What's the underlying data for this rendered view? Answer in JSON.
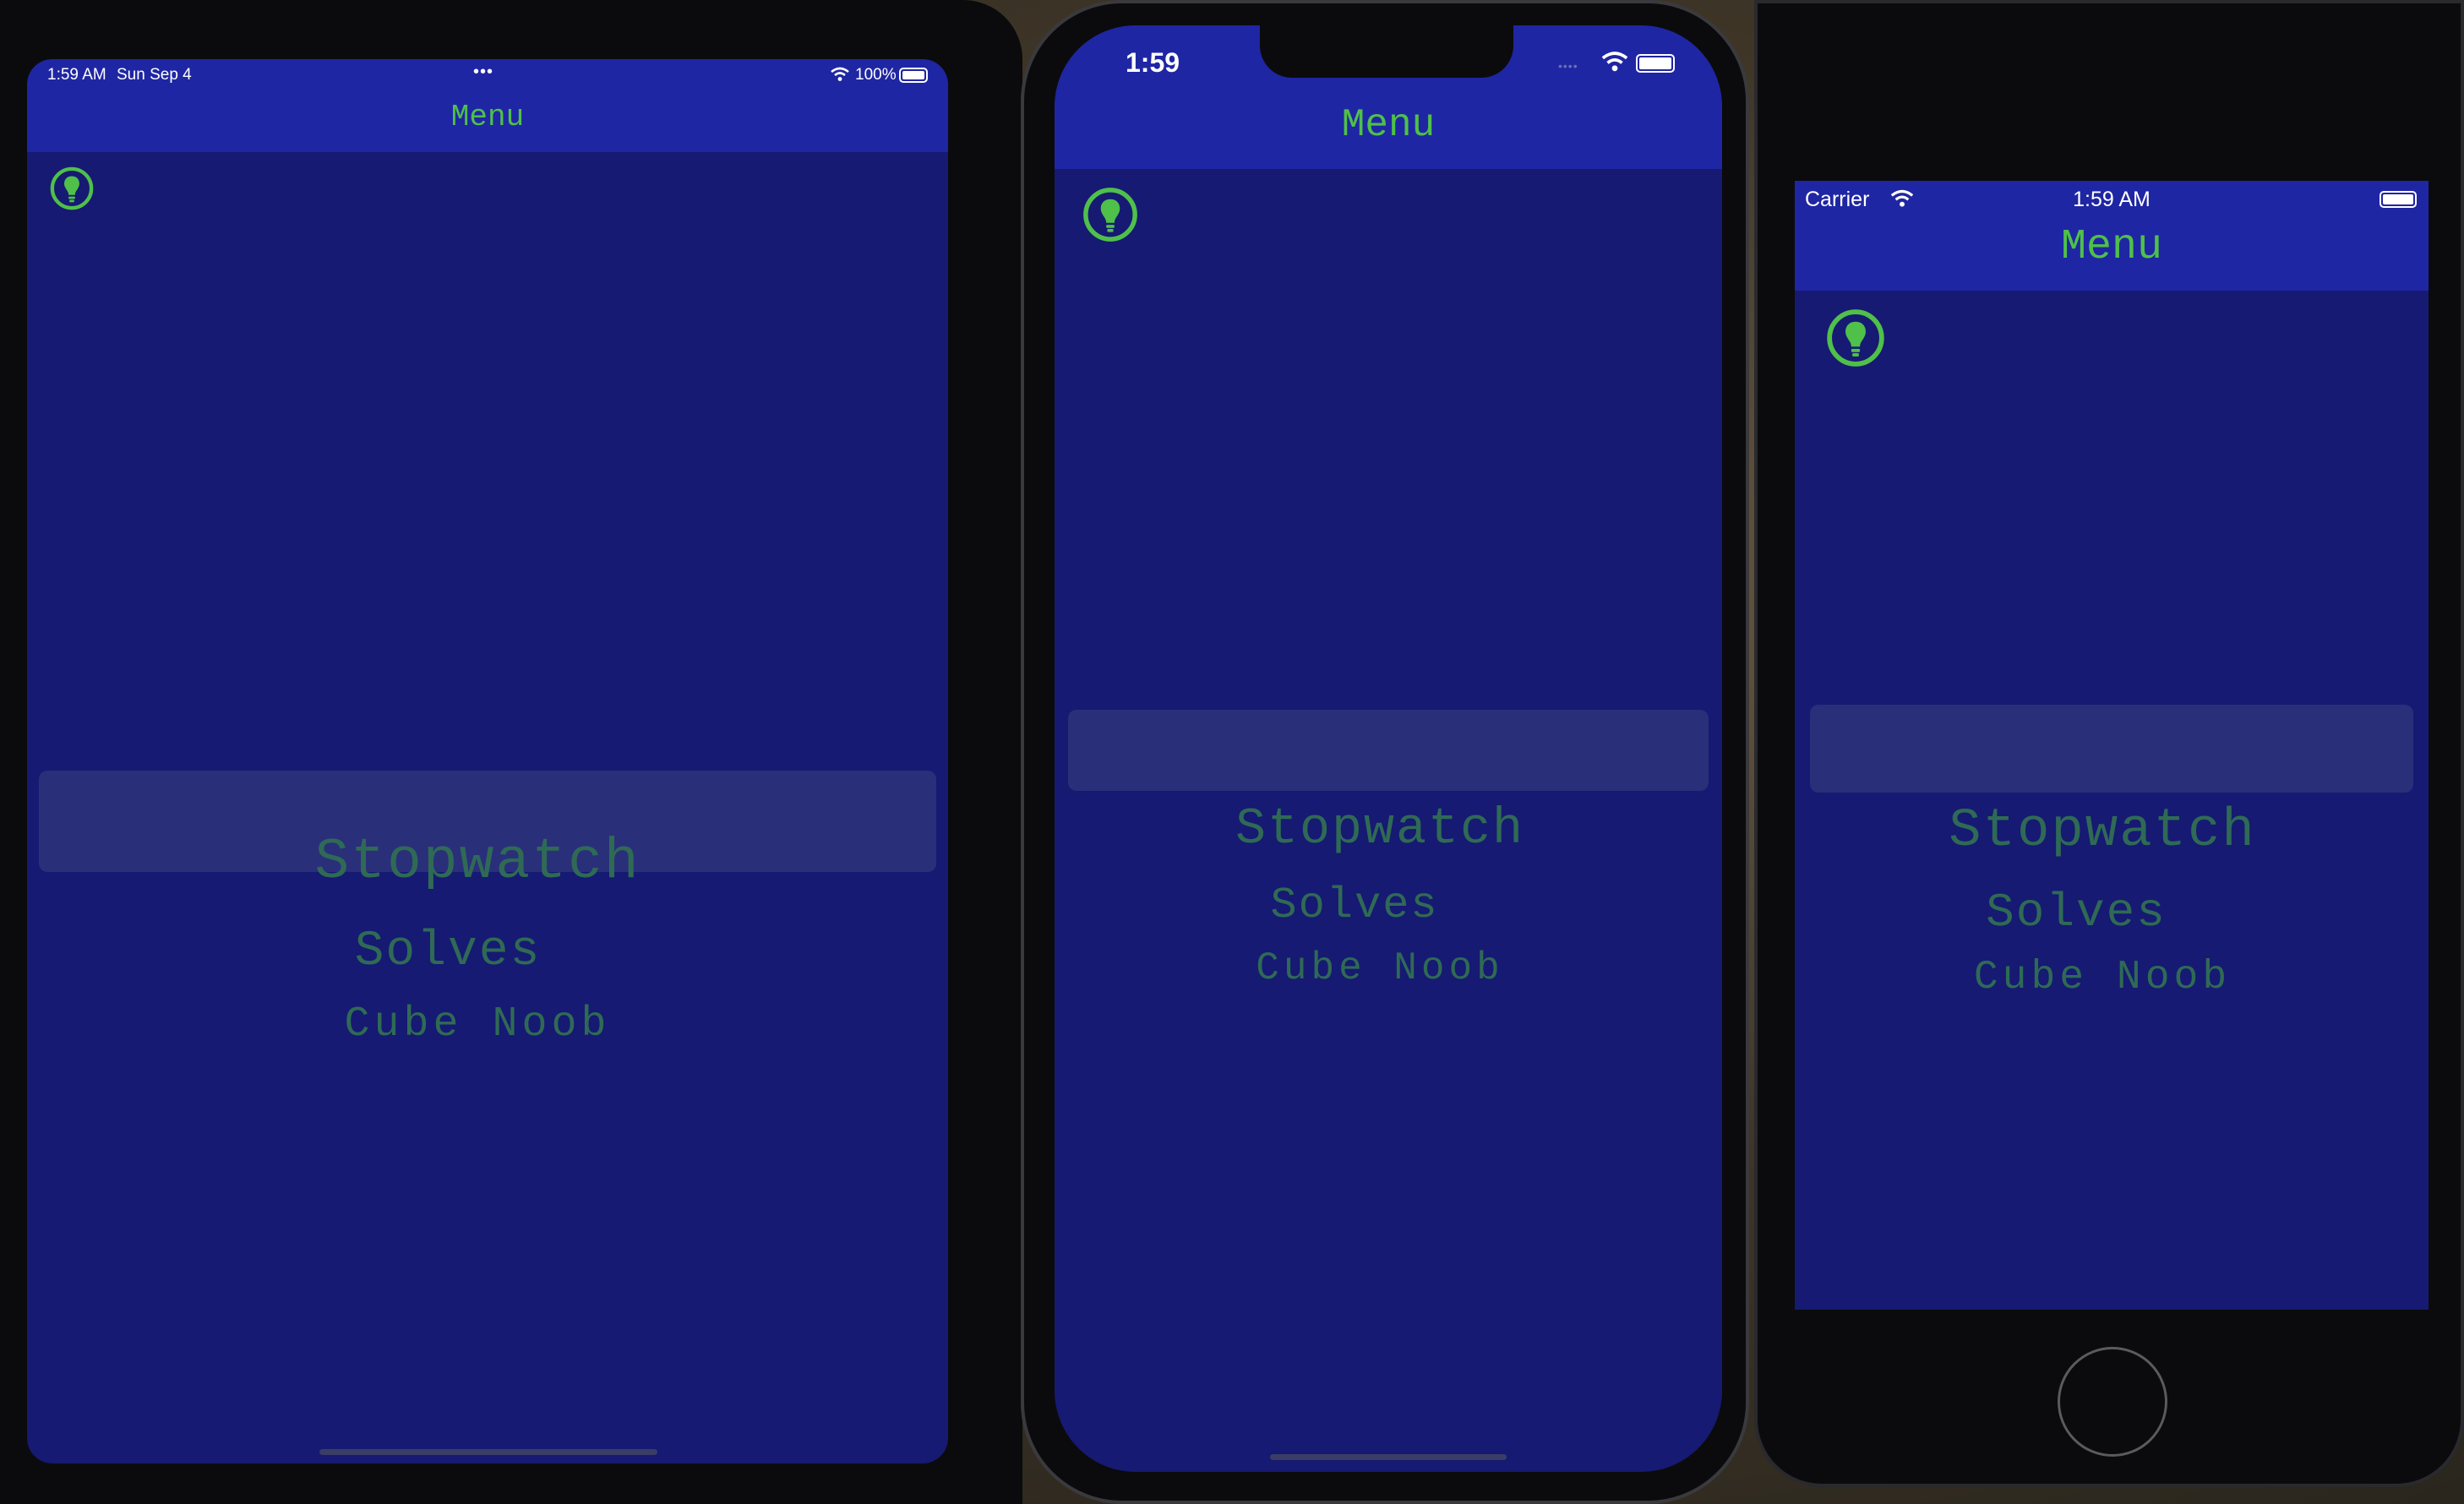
{
  "colors": {
    "navbar": "#1f26a3",
    "content": "#161a72",
    "accent_green": "#4fc04a",
    "picker_text": "#2f6a55",
    "selection_band": "#2a2f7a"
  },
  "ipad": {
    "status_time": "1:59 AM",
    "status_date": "Sun Sep 4",
    "multitask_dots": "•••",
    "battery_pct": "100%",
    "title": "Menu",
    "picker": [
      "Stopwatch",
      "Solves",
      "Cube Noob"
    ]
  },
  "iphone_notch": {
    "status_time": "1:59",
    "signal_dots": "••••",
    "title": "Menu",
    "picker": [
      "Stopwatch",
      "Solves",
      "Cube Noob"
    ]
  },
  "iphone_se": {
    "carrier": "Carrier",
    "status_time": "1:59 AM",
    "title": "Menu",
    "picker": [
      "Stopwatch",
      "Solves",
      "Cube Noob"
    ]
  },
  "icons": {
    "bulb": "lightbulb-icon",
    "wifi": "wifi-icon",
    "battery": "battery-icon"
  }
}
